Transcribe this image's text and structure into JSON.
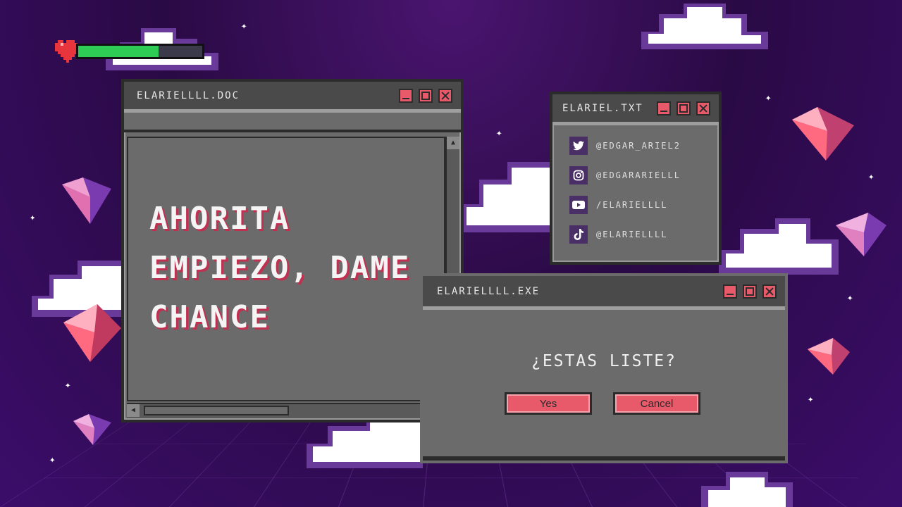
{
  "health_bar": {
    "level": 0.65,
    "fill_color": "#2ecc54",
    "heart_color": "#e8343c"
  },
  "doc_window": {
    "title": "ELARIELLLL.DOC",
    "body_lines": [
      "AHORITA",
      "EMPIEZO, DAME",
      "CHANCE"
    ]
  },
  "txt_window": {
    "title": "ELARIEL.TXT",
    "socials": [
      {
        "icon": "twitter-icon",
        "handle": "@EDGAR_ARIEL2"
      },
      {
        "icon": "instagram-icon",
        "handle": "@EDGARARIELLL"
      },
      {
        "icon": "youtube-icon",
        "handle": "/ELARIELLLL"
      },
      {
        "icon": "tiktok-icon",
        "handle": "@ELARIELLLL"
      }
    ]
  },
  "exe_window": {
    "title": "ELARIELLLL.EXE",
    "question": "¿ESTAS LISTE?",
    "yes_label": "Yes",
    "cancel_label": "Cancel"
  },
  "colors": {
    "accent": "#e85a6a",
    "window": "#6b6b6b",
    "titlebar": "#4a4a4a",
    "background": "#2a0a45"
  }
}
